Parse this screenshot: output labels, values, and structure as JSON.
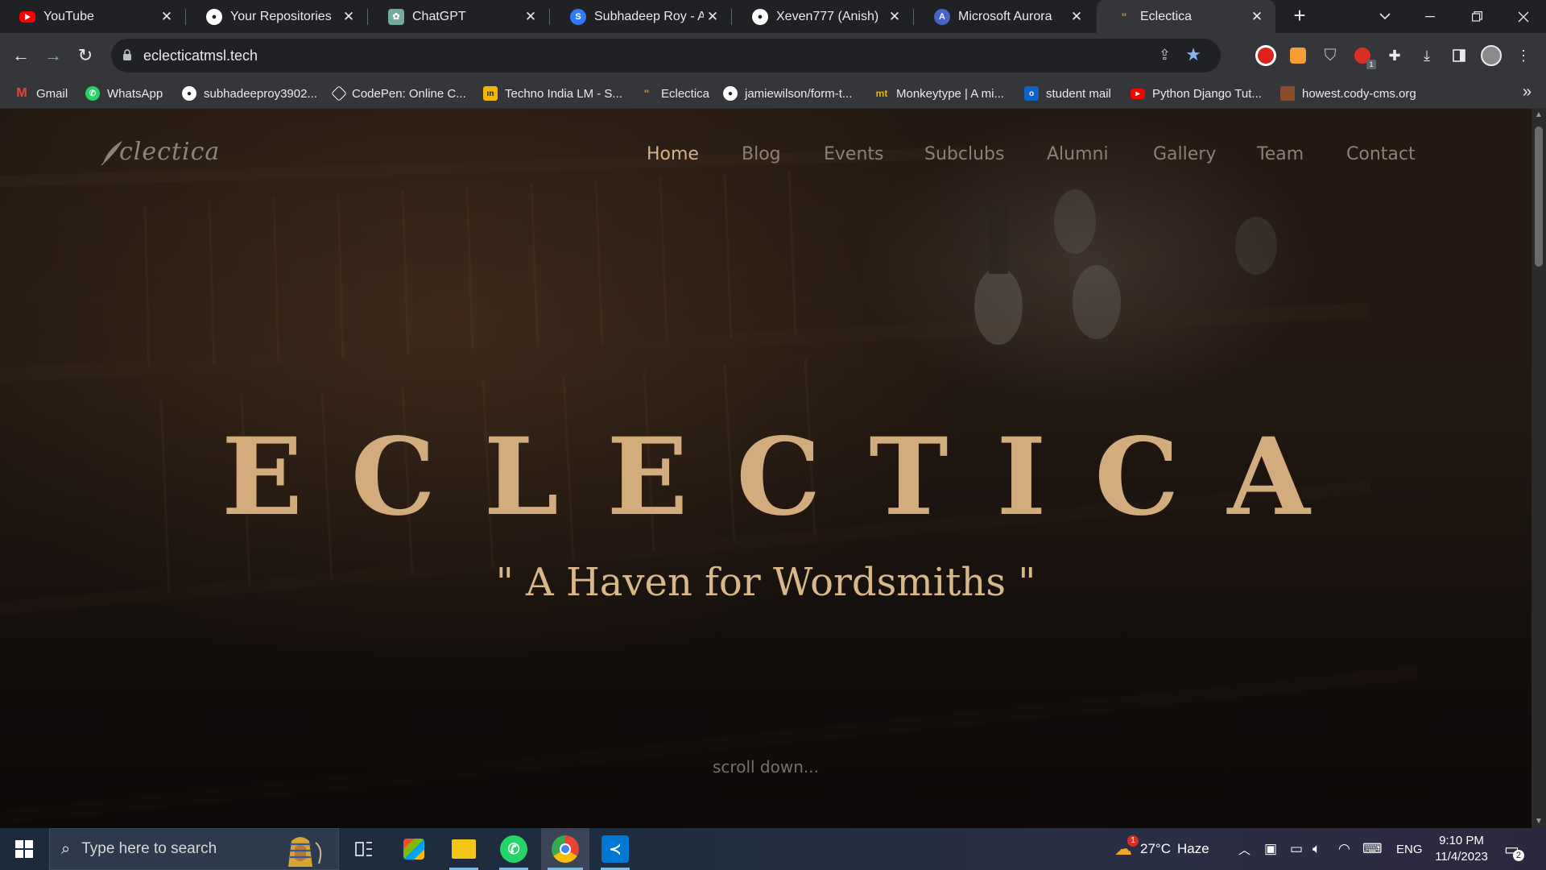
{
  "browser": {
    "tabs": [
      {
        "title": "YouTube",
        "icon": "youtube-icon",
        "color": "#ff0000"
      },
      {
        "title": "Your Repositories",
        "icon": "github-icon",
        "color": "#ffffff"
      },
      {
        "title": "ChatGPT",
        "icon": "chatgpt-icon",
        "color": "#74aa9c"
      },
      {
        "title": "Subhadeep Roy - A V",
        "icon": "stackshare-icon",
        "color": "#2f7bf5"
      },
      {
        "title": "Xeven777 (Anish)",
        "icon": "github-icon",
        "color": "#ffffff"
      },
      {
        "title": "Microsoft Aurora",
        "icon": "aurora-icon",
        "color": "#4a63c8"
      },
      {
        "title": "Eclectica",
        "icon": "eclectica-icon",
        "color": "#b08a5a",
        "active": true
      }
    ],
    "url": "eclecticatmsl.tech",
    "bookmarks": [
      {
        "label": "Gmail",
        "icon": "gmail-icon",
        "color": "#ea4335"
      },
      {
        "label": "WhatsApp",
        "icon": "whatsapp-icon",
        "color": "#25d366"
      },
      {
        "label": "subhadeeproy3902...",
        "icon": "github-icon",
        "color": "#ffffff"
      },
      {
        "label": "CodePen: Online C...",
        "icon": "codepen-icon",
        "color": "#ffffff"
      },
      {
        "label": "Techno India LM - S...",
        "icon": "techno-india-icon",
        "color": "#f4b400"
      },
      {
        "label": "Eclectica",
        "icon": "eclectica-icon",
        "color": "#b08a5a"
      },
      {
        "label": "jamiewilson/form-t...",
        "icon": "github-icon",
        "color": "#ffffff"
      },
      {
        "label": "Monkeytype | A mi...",
        "icon": "monkeytype-icon",
        "color": "#e2b714"
      },
      {
        "label": "student mail",
        "icon": "outlook-icon",
        "color": "#0a64c8"
      },
      {
        "label": "Python Django Tut...",
        "icon": "youtube-icon",
        "color": "#ff0000"
      },
      {
        "label": "howest.cody-cms.org",
        "icon": "howest-icon",
        "color": "#8a4b2a"
      }
    ]
  },
  "site": {
    "logo_text": "clectica",
    "nav": [
      "Home",
      "Blog",
      "Events",
      "Subclubs",
      "Alumni",
      "Gallery",
      "Team",
      "Contact"
    ],
    "active_nav": "Home",
    "hero_title": "ECLECTICA",
    "hero_subtitle": "\" A Haven for Wordsmiths \"",
    "scroll_hint": "scroll down...",
    "colors": {
      "accent": "#d2ac7d",
      "nav": "#8d8073",
      "background": "#231912"
    }
  },
  "taskbar": {
    "search_placeholder": "Type here to search",
    "apps": [
      {
        "name": "task-view-icon",
        "running": false
      },
      {
        "name": "microsoft-store-icon",
        "running": false
      },
      {
        "name": "file-explorer-icon",
        "running": true
      },
      {
        "name": "whatsapp-icon",
        "running": true
      },
      {
        "name": "chrome-icon",
        "running": true,
        "active": true
      },
      {
        "name": "vscode-icon",
        "running": true
      }
    ],
    "weather": {
      "temp": "27°C",
      "condition": "Haze",
      "badge": "1"
    },
    "language": "ENG",
    "time": "9:10 PM",
    "date": "11/4/2023",
    "notifications": "2"
  }
}
